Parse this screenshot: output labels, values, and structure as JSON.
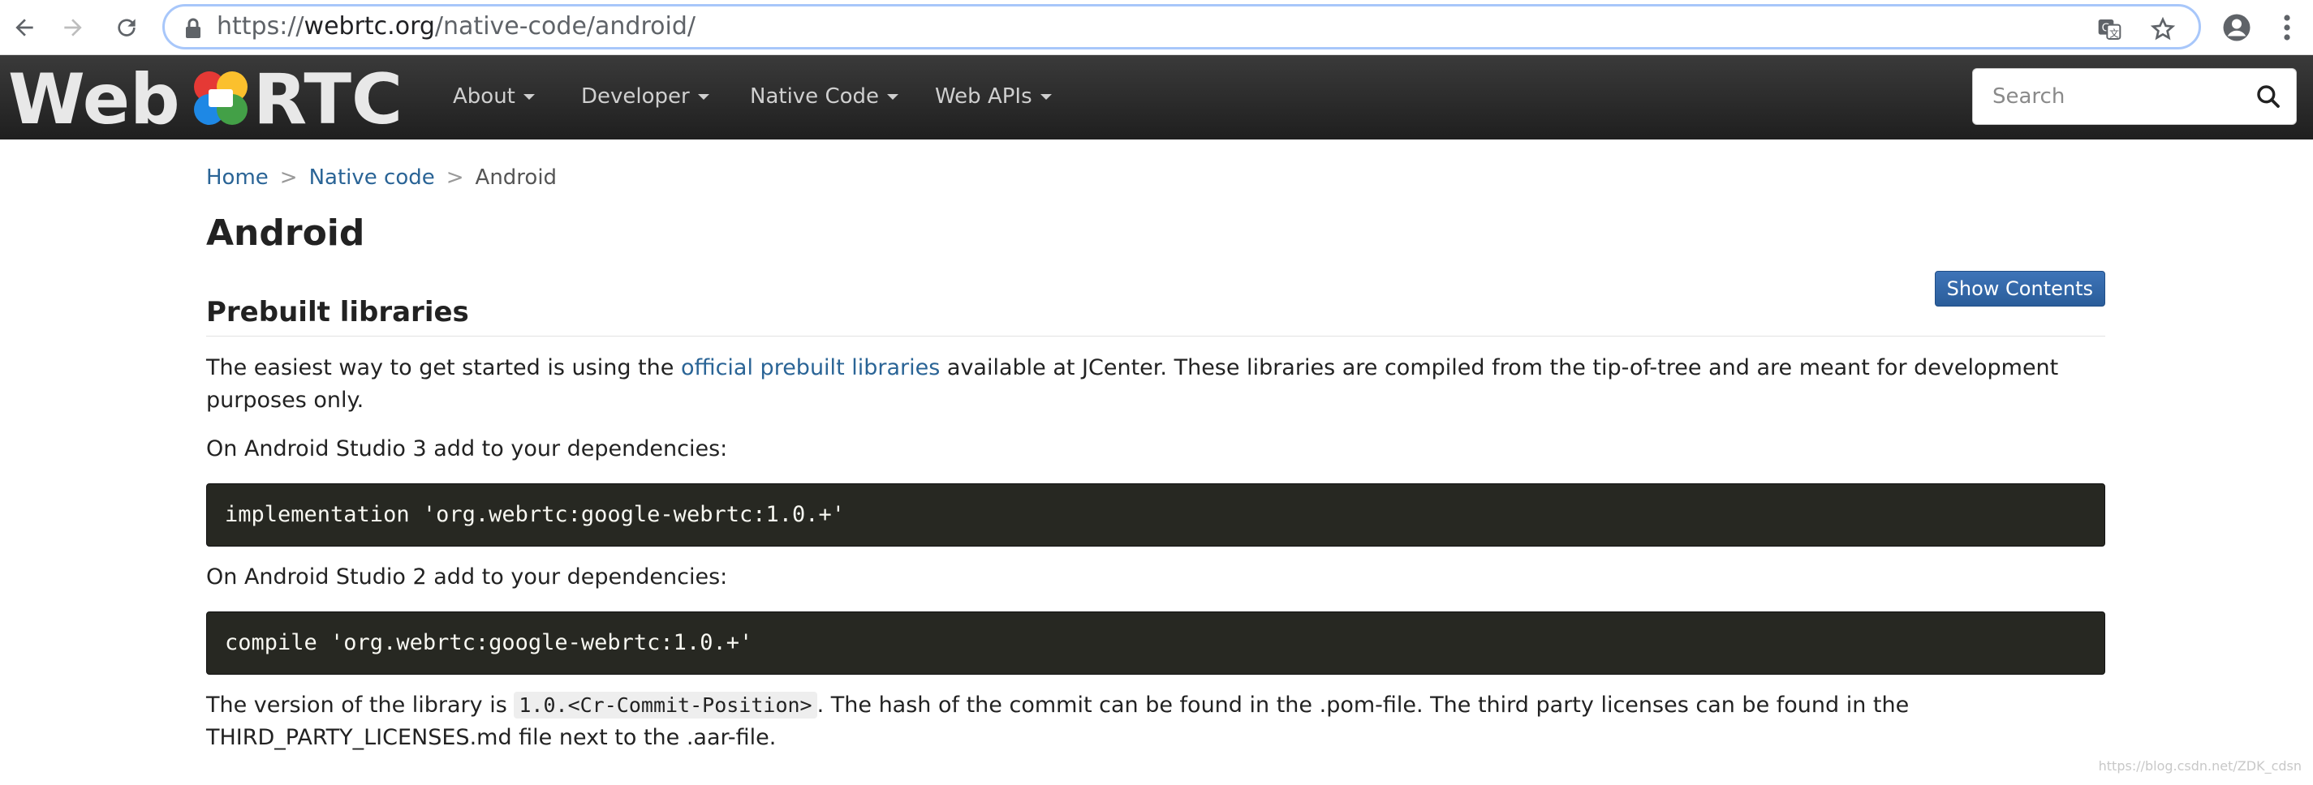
{
  "browser": {
    "url_host_prefix": "https://",
    "url_host": "webrtc.org",
    "url_path": "/native-code/android/",
    "icons": [
      "back-arrow-icon",
      "forward-arrow-icon",
      "reload-icon",
      "lock-icon",
      "translate-icon",
      "star-icon",
      "account-icon",
      "menu-dots-icon"
    ]
  },
  "navbar": {
    "logo_text": "WebRTC",
    "items": [
      {
        "label": "About"
      },
      {
        "label": "Developer"
      },
      {
        "label": "Native Code"
      },
      {
        "label": "Web APIs"
      }
    ],
    "search_placeholder": "Search"
  },
  "breadcrumb": {
    "home": "Home",
    "sep": ">",
    "native_code": "Native code",
    "current": "Android"
  },
  "page": {
    "title": "Android",
    "show_contents_label": "Show Contents",
    "section_title": "Prebuilt libraries",
    "p1_before": "The easiest way to get started is using the ",
    "p1_link": "official prebuilt libraries",
    "p1_after": " available at JCenter. These libraries are compiled from the tip-of-tree and are meant for development purposes only.",
    "p2": "On Android Studio 3 add to your dependencies:",
    "code1": "implementation 'org.webrtc:google-webrtc:1.0.+'",
    "p3": "On Android Studio 2 add to your dependencies:",
    "code2": "compile 'org.webrtc:google-webrtc:1.0.+'",
    "p4_before": "The version of the library is ",
    "p4_code": "1.0.<Cr-Commit-Position>",
    "p4_after": ". The hash of the commit can be found in the .pom-file. The third party licenses can be found in the THIRD_PARTY_LICENSES.md file next to the .aar-file."
  },
  "watermark": "https://blog.csdn.net/ZDK_cdsn",
  "colors": {
    "link": "#2a6496",
    "navbar_bg": "#2a2a2a",
    "code_bg": "#272822",
    "button_bg": "#2f639f"
  }
}
